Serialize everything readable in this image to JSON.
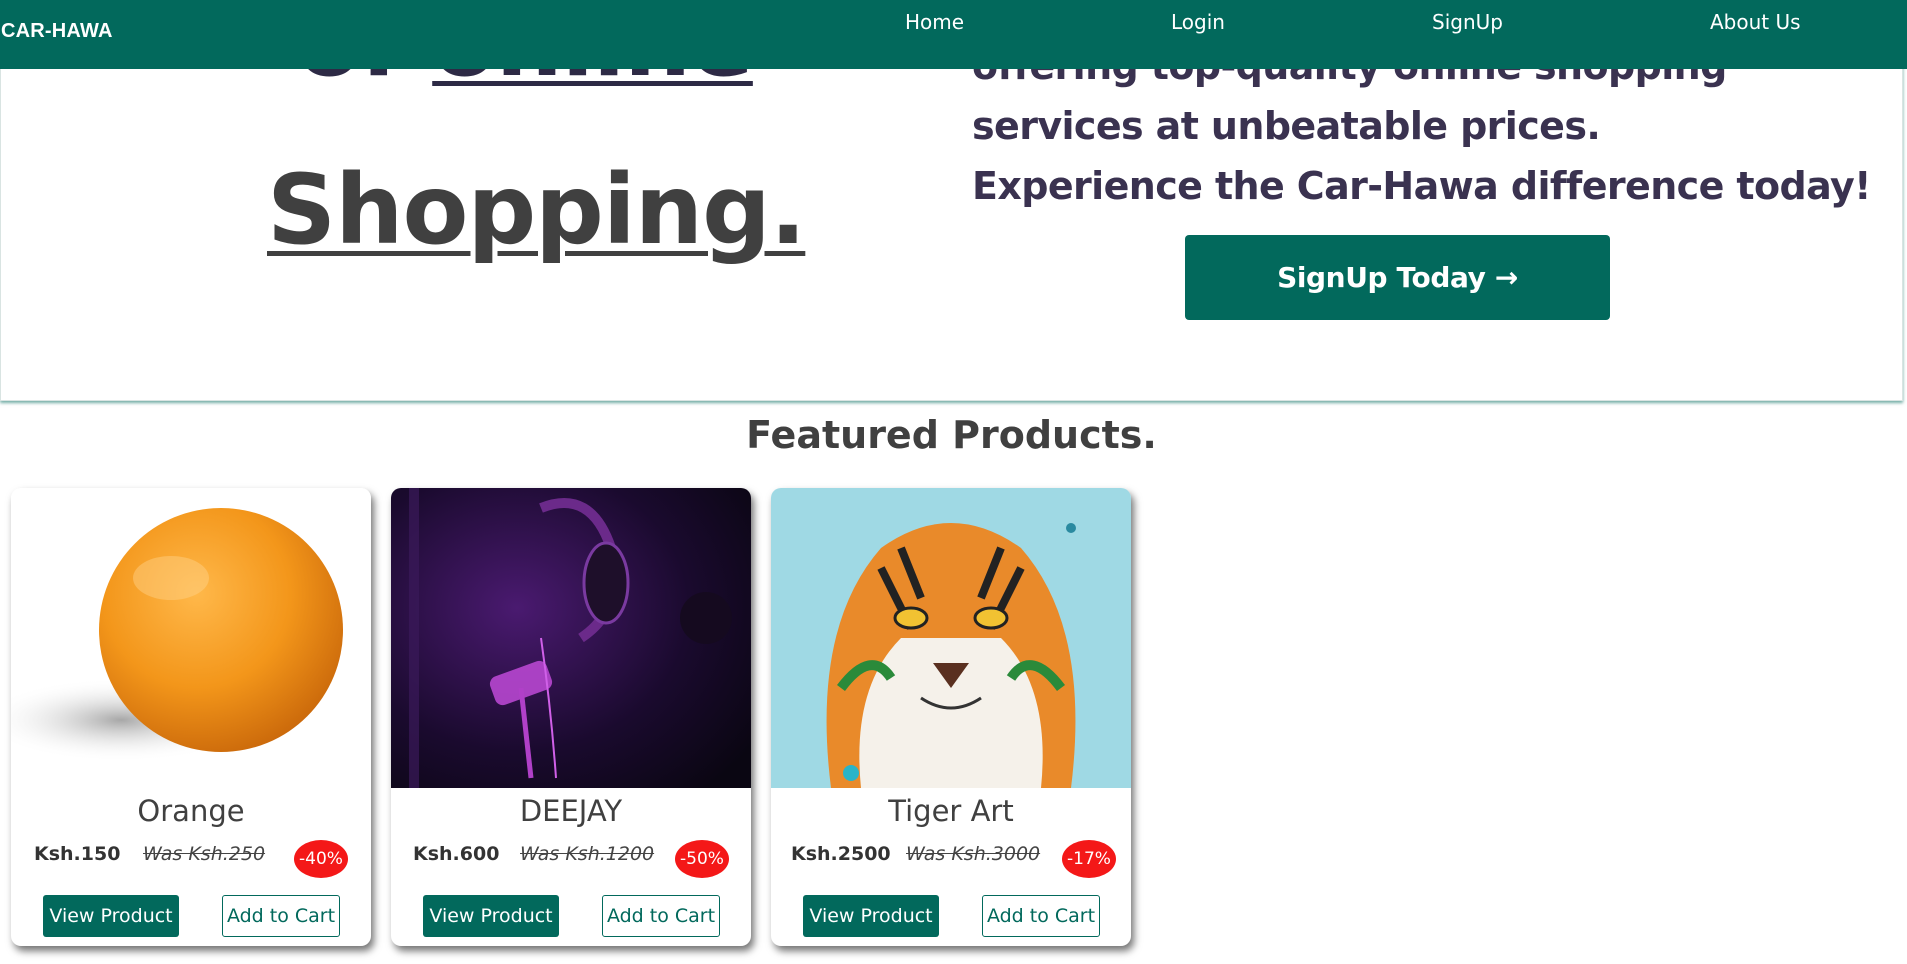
{
  "navbar": {
    "brand": "CAR-HAWA",
    "links": [
      {
        "label": "Home"
      },
      {
        "label": "Login"
      },
      {
        "label": "SignUp"
      },
      {
        "label": "About Us"
      }
    ]
  },
  "hero": {
    "headline_word_a": "of",
    "headline_word_b": "online",
    "headline_line2": "Shopping.",
    "text_line1": "offering top-quality online shopping",
    "text_line2": "services at unbeatable prices.",
    "text_line3": "Experience the Car-Hawa difference today!",
    "cta_label": "SignUp Today →"
  },
  "featured": {
    "title": "Featured Products.",
    "products": [
      {
        "name": "Orange",
        "price": "Ksh.150",
        "old_price": "Was Ksh.250",
        "discount": "-40%",
        "view_label": "View Product",
        "cart_label": "Add to Cart",
        "image": "orange-photo"
      },
      {
        "name": "DEEJAY",
        "price": "Ksh.600",
        "old_price": "Was Ksh.1200",
        "discount": "-50%",
        "view_label": "View Product",
        "cart_label": "Add to Cart",
        "image": "studio-microphone-photo"
      },
      {
        "name": "Tiger Art",
        "price": "Ksh.2500",
        "old_price": "Was Ksh.3000",
        "discount": "-17%",
        "view_label": "View Product",
        "cart_label": "Add to Cart",
        "image": "tiger-painting"
      }
    ]
  },
  "colors": {
    "brand_green": "#02695c",
    "discount_red": "#f41818",
    "hero_text": "#3a3250"
  }
}
